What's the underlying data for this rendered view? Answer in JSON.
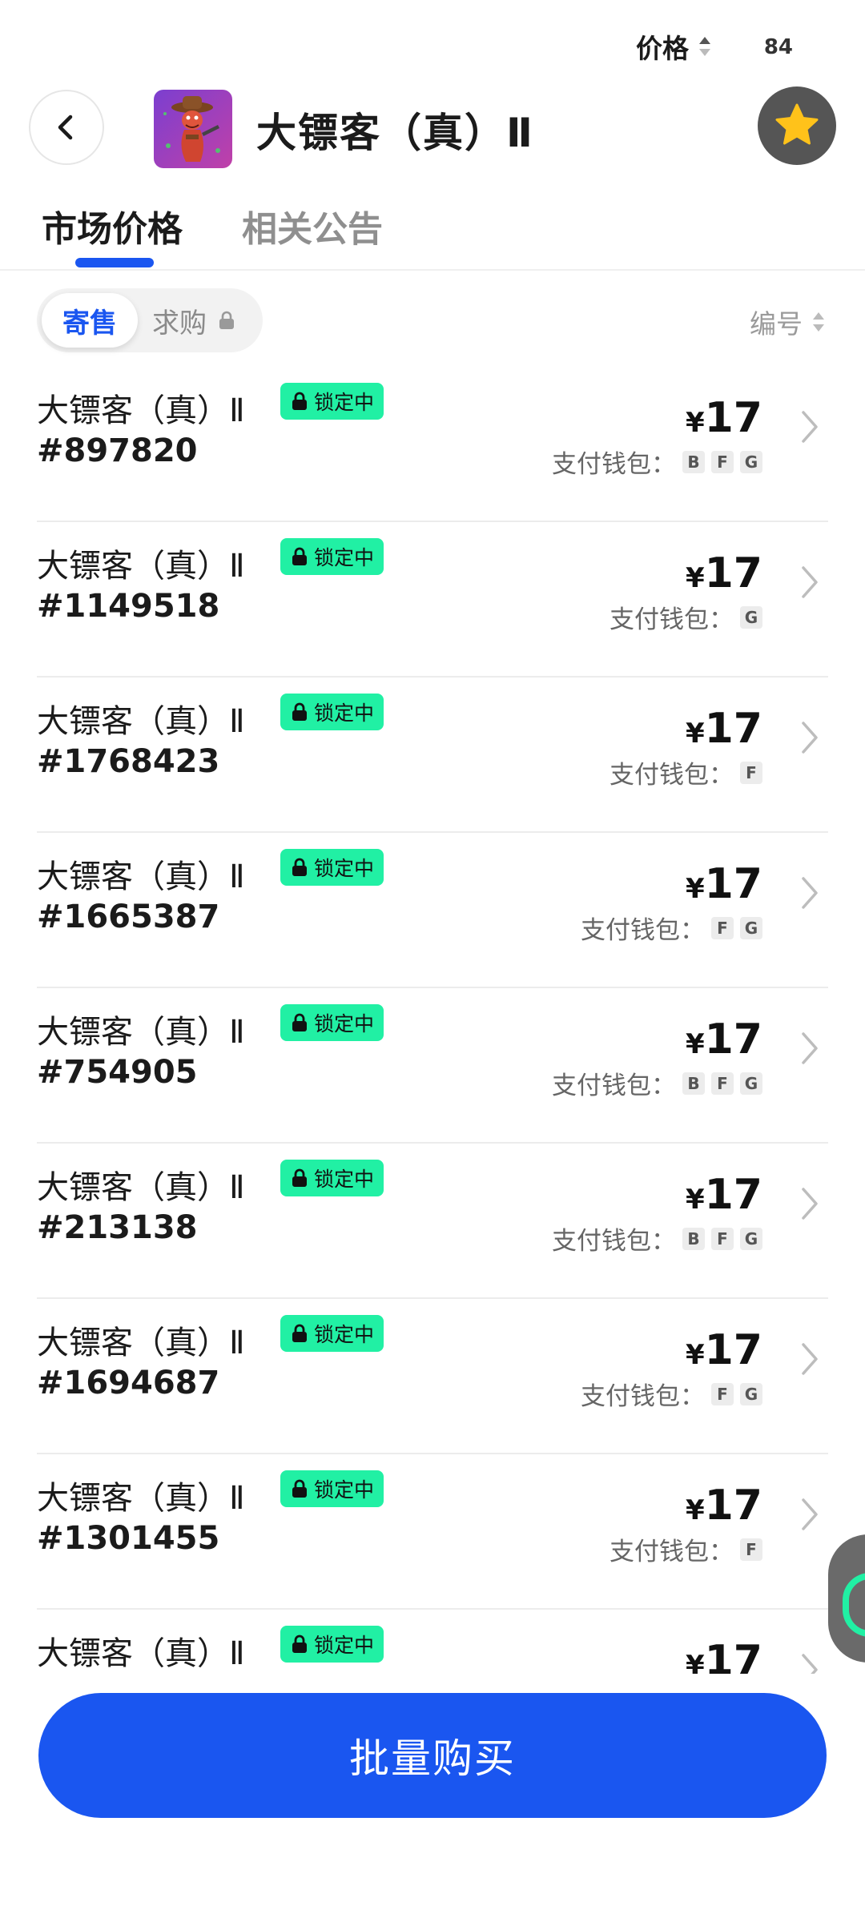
{
  "status": {
    "number": "84"
  },
  "header": {
    "title": "大镖客（真）Ⅱ"
  },
  "tabs": [
    {
      "label": "市场价格"
    },
    {
      "label": "相关公告"
    }
  ],
  "segment": {
    "active": "寄售",
    "inactive": "求购"
  },
  "sort": {
    "price": "价格",
    "number": "编号"
  },
  "badge_label": "锁定中",
  "wallet_label": "支付钱包：",
  "currency": "¥",
  "items": [
    {
      "name": "大镖客（真）Ⅱ",
      "serial": "#897820",
      "price": "17",
      "wallets": [
        "B",
        "F",
        "G"
      ]
    },
    {
      "name": "大镖客（真）Ⅱ",
      "serial": "#1149518",
      "price": "17",
      "wallets": [
        "G"
      ]
    },
    {
      "name": "大镖客（真）Ⅱ",
      "serial": "#1768423",
      "price": "17",
      "wallets": [
        "F"
      ]
    },
    {
      "name": "大镖客（真）Ⅱ",
      "serial": "#1665387",
      "price": "17",
      "wallets": [
        "F",
        "G"
      ]
    },
    {
      "name": "大镖客（真）Ⅱ",
      "serial": "#754905",
      "price": "17",
      "wallets": [
        "B",
        "F",
        "G"
      ]
    },
    {
      "name": "大镖客（真）Ⅱ",
      "serial": "#213138",
      "price": "17",
      "wallets": [
        "B",
        "F",
        "G"
      ]
    },
    {
      "name": "大镖客（真）Ⅱ",
      "serial": "#1694687",
      "price": "17",
      "wallets": [
        "F",
        "G"
      ]
    },
    {
      "name": "大镖客（真）Ⅱ",
      "serial": "#1301455",
      "price": "17",
      "wallets": [
        "F"
      ]
    },
    {
      "name": "大镖客（真）Ⅱ",
      "serial": "",
      "price": "17",
      "wallets": []
    }
  ],
  "footer": {
    "buy_label": "批量购买"
  },
  "colors": {
    "accent": "#1a56f0",
    "badge": "#21f0a4",
    "favorite": "#ffc21a"
  },
  "icons": {
    "back": "chevron-left-icon",
    "favorite": "star-icon",
    "lock": "lock-icon",
    "sort": "sort-icon",
    "row": "chevron-right-icon"
  }
}
